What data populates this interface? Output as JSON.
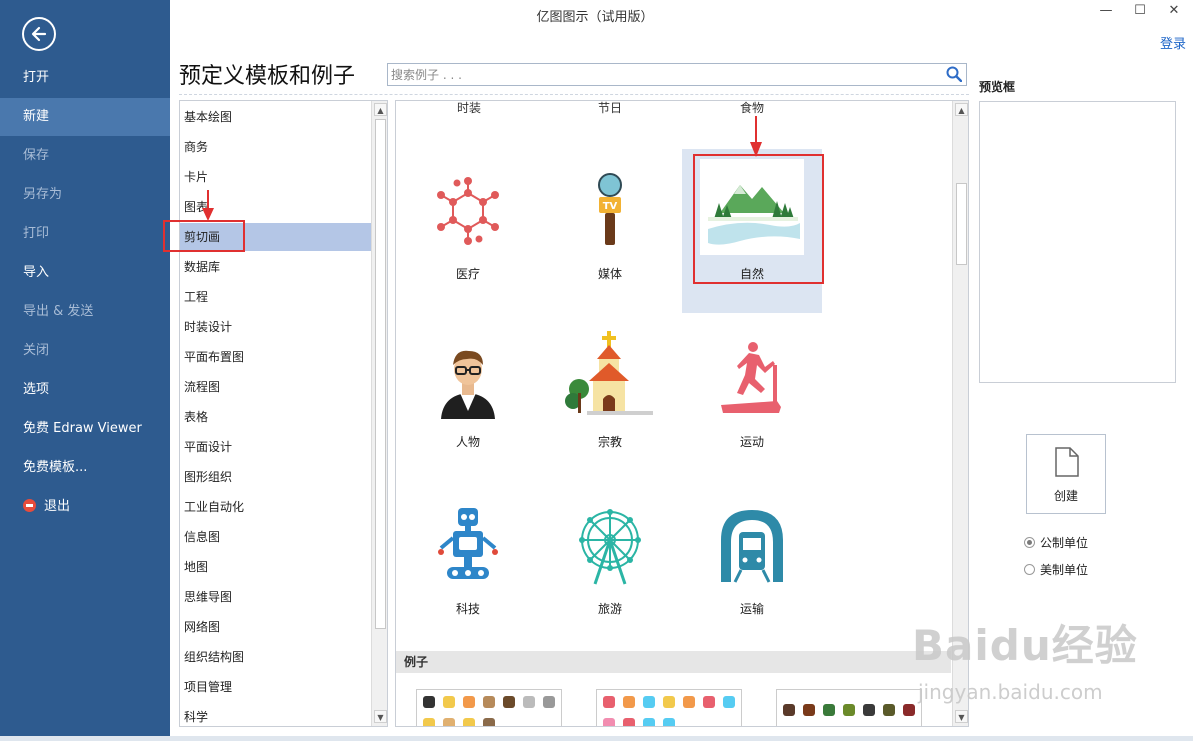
{
  "window": {
    "title": "亿图图示（试用版）",
    "minimize_glyph": "—",
    "maximize_glyph": "☐",
    "close_glyph": "✕",
    "login": "登录"
  },
  "sidebar": {
    "items": [
      {
        "label": "打开",
        "state": "normal"
      },
      {
        "label": "新建",
        "state": "active"
      },
      {
        "label": "保存",
        "state": "disabled"
      },
      {
        "label": "另存为",
        "state": "disabled"
      },
      {
        "label": "打印",
        "state": "disabled"
      },
      {
        "label": "导入",
        "state": "normal"
      },
      {
        "label": "导出 & 发送",
        "state": "disabled"
      },
      {
        "label": "关闭",
        "state": "disabled"
      },
      {
        "label": "选项",
        "state": "normal"
      },
      {
        "label": "免费 Edraw Viewer",
        "state": "normal"
      },
      {
        "label": "免费模板...",
        "state": "normal"
      },
      {
        "label": "退出",
        "state": "normal"
      }
    ]
  },
  "main": {
    "heading": "预定义模板和例子",
    "search_placeholder": "搜索例子 . . .",
    "categories": [
      "基本绘图",
      "商务",
      "卡片",
      "图表",
      "剪切画",
      "数据库",
      "工程",
      "时装设计",
      "平面布置图",
      "流程图",
      "表格",
      "平面设计",
      "图形组织",
      "工业自动化",
      "信息图",
      "地图",
      "思维导图",
      "网络图",
      "组织结构图",
      "项目管理",
      "科学"
    ],
    "selected_category": "剪切画",
    "top_row_labels": [
      "时装",
      "节日",
      "食物"
    ],
    "templates": [
      {
        "label": "医疗",
        "icon": "molecule-icon"
      },
      {
        "label": "媒体",
        "icon": "tv-microphone-icon"
      },
      {
        "label": "自然",
        "icon": "mountain-landscape-icon",
        "selected": true
      },
      {
        "label": "人物",
        "icon": "person-glasses-icon"
      },
      {
        "label": "宗教",
        "icon": "church-icon"
      },
      {
        "label": "运动",
        "icon": "treadmill-runner-icon"
      },
      {
        "label": "科技",
        "icon": "robot-icon"
      },
      {
        "label": "旅游",
        "icon": "ferris-wheel-icon"
      },
      {
        "label": "运输",
        "icon": "train-tunnel-icon"
      }
    ],
    "examples_header": "例子"
  },
  "preview": {
    "label": "预览框",
    "create": "创建",
    "units": [
      {
        "label": "公制单位",
        "checked": true
      },
      {
        "label": "美制单位",
        "checked": false
      }
    ]
  },
  "watermark": {
    "brand": "Baidu经验",
    "url": "jingyan.baidu.com"
  },
  "colors": {
    "sidebar": "#2e5b8f",
    "sidebar_active": "#4a78ad",
    "selection": "#b4c6e6",
    "highlight_red": "#e03030"
  }
}
